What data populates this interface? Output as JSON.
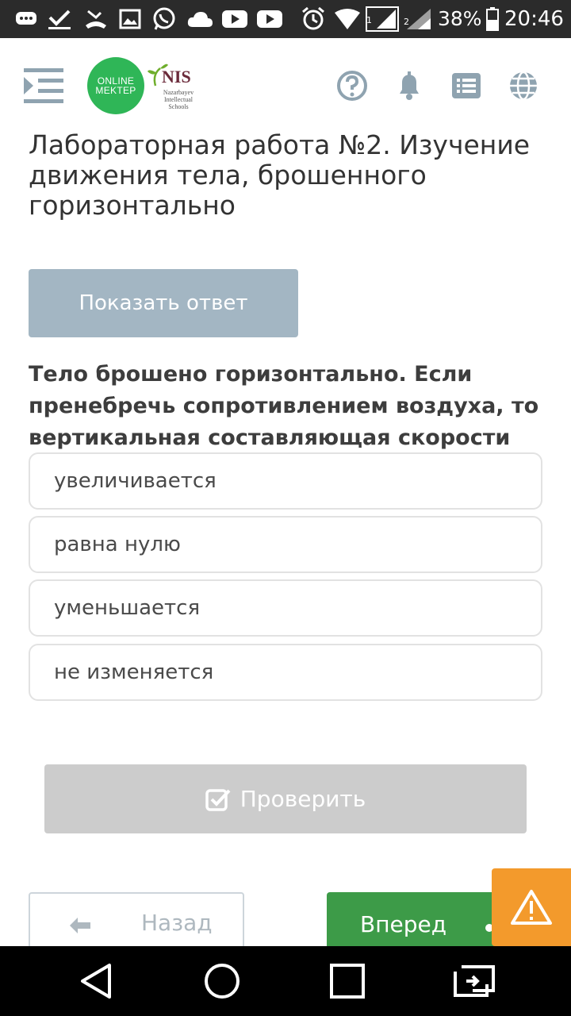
{
  "status_bar": {
    "battery": "38%",
    "time": "20:46",
    "sim1": "1",
    "sim2": "2"
  },
  "header": {
    "logo_online_line1": "ONLINE",
    "logo_online_line2": "MEKTEP",
    "logo_nis": "NIS",
    "logo_nis_sub": "Nazarbayev Intellectual Schools"
  },
  "page": {
    "title": "Лабораторная работа №2. Изучение движения тела, брошенного горизонтально",
    "show_answer_label": "Показать ответ",
    "question": "Тело брошено горизонтально. Если пренебречь сопротивлением воздуха, то вертикальная составляющая скорости",
    "options": [
      "увеличивается",
      "равна нулю",
      "уменьшается",
      "не изменяется"
    ],
    "check_label": "Проверить",
    "back_label": "Назад",
    "next_label": "Вперед"
  },
  "colors": {
    "accent_green": "#3d9b48",
    "online_mektep_green": "#2fb657",
    "show_answer_bg": "#a3b6c3",
    "check_disabled_bg": "#cccccc",
    "warning_orange": "#f39a2c",
    "header_icon_color": "#8fa3b0"
  }
}
